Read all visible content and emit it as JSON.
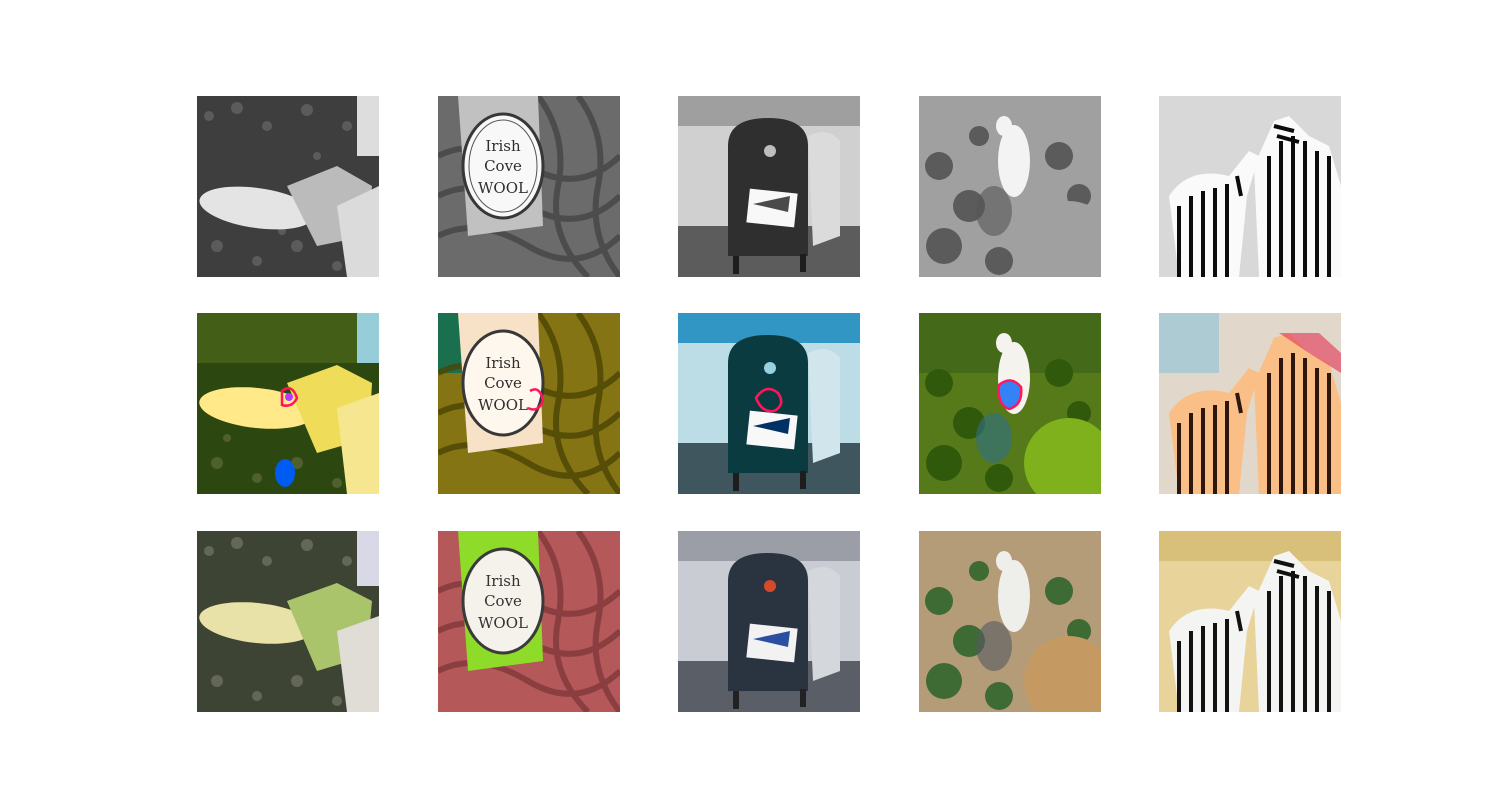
{
  "figure": {
    "rows": [
      {
        "row_kind": "grayscale-input"
      },
      {
        "row_kind": "colorized-prediction"
      },
      {
        "row_kind": "ground-truth-color"
      }
    ],
    "columns": [
      {
        "subject": "corn-cob-held-in-hand"
      },
      {
        "subject": "yarn-skein-with-label",
        "label_lines": [
          "Irish",
          "Cove",
          "WOOL"
        ]
      },
      {
        "subject": "blue-mailbox-on-street"
      },
      {
        "subject": "white-dog-in-garden"
      },
      {
        "subject": "two-zebras"
      }
    ]
  },
  "colors": {
    "background": "#ffffff",
    "grass_dark": "#2f3a2a",
    "corn_yellow": "#e9e2a8",
    "husk_green": "#a9c46a",
    "yarn_red": "#b5585a",
    "label_green": "#8edb2a",
    "mailbox_blue": "#2a3440",
    "dog_white": "#eeeeea",
    "zebra_bg": "#e8d39a",
    "highlight_red": "#e53030",
    "highlight_blue": "#3a4ed8"
  }
}
